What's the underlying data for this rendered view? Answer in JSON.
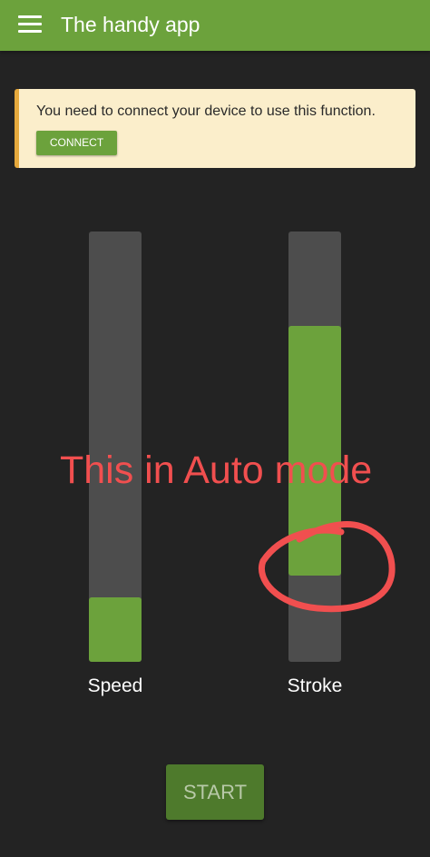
{
  "appbar": {
    "title": "The handy app",
    "menu_icon": "hamburger-menu-icon"
  },
  "notice": {
    "message": "You need to connect your device to use this function.",
    "button_label": "CONNECT"
  },
  "sliders": {
    "speed": {
      "label": "Speed",
      "level": 0.15
    },
    "stroke": {
      "label": "Stroke",
      "level_min": 0.2,
      "level_max": 0.78
    }
  },
  "start_button": {
    "label": "START"
  },
  "annotation": {
    "text": "This in Auto mode"
  },
  "colors": {
    "primary": "#6ca23c",
    "background": "#232323",
    "track": "#4d4d4d",
    "notice_bg": "#fbeecb",
    "notice_border": "#e6a93c",
    "annotation": "#f14f4f"
  }
}
